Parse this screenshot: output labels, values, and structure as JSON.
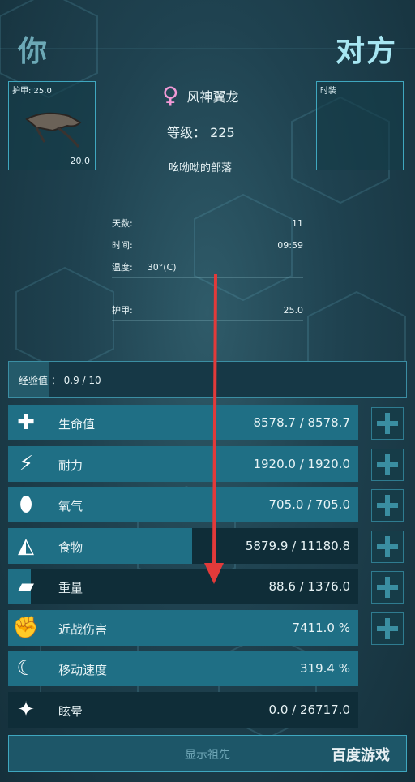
{
  "header": {
    "you": "你",
    "them": "对方"
  },
  "armor_slot": {
    "label": "护甲: 25.0",
    "value": "20.0"
  },
  "costume_slot": {
    "label": "时装"
  },
  "creature": {
    "name": "风神翼龙",
    "level_label": "等级：",
    "level_value": "225",
    "tribe": "吆呦呦的部落"
  },
  "info": [
    {
      "label": "天数:",
      "value": "11"
    },
    {
      "label": "时间:",
      "value": "09:59"
    },
    {
      "label": "温度:",
      "value": "30°(C)"
    },
    {
      "label": "",
      "value": ""
    },
    {
      "label": "护甲:",
      "value": "25.0"
    }
  ],
  "xp": {
    "text": "经验值 ： 0.9 / 10",
    "fraction": 0.1
  },
  "stats": [
    {
      "name": "health",
      "icon": "plus-cross-icon",
      "label": "生命值",
      "value": "8578.7 / 8578.7",
      "fraction": 1.0,
      "upgradable": true
    },
    {
      "name": "stamina",
      "icon": "lightning-icon",
      "label": "耐力",
      "value": "1920.0 / 1920.0",
      "fraction": 1.0,
      "upgradable": true
    },
    {
      "name": "oxygen",
      "icon": "oxygen-tank-icon",
      "label": "氧气",
      "value": "705.0 / 705.0",
      "fraction": 1.0,
      "upgradable": true
    },
    {
      "name": "food",
      "icon": "food-bag-icon",
      "label": "食物",
      "value": "5879.9 / 11180.8",
      "fraction": 0.526,
      "upgradable": true
    },
    {
      "name": "weight",
      "icon": "weight-icon",
      "label": "重量",
      "value": "88.6 / 1376.0",
      "fraction": 0.064,
      "upgradable": true
    },
    {
      "name": "melee",
      "icon": "fist-icon",
      "label": "近战伤害",
      "value": "7411.0 %",
      "fraction": 1.0,
      "upgradable": true
    },
    {
      "name": "speed",
      "icon": "foot-icon",
      "label": "移动速度",
      "value": "319.4 %",
      "fraction": 1.0,
      "upgradable": false
    },
    {
      "name": "torpor",
      "icon": "stars-icon",
      "label": "眩晕",
      "value": "0.0 / 26717.0",
      "fraction": 0.0,
      "upgradable": false
    }
  ],
  "ancestor_button": "显示祖先",
  "watermark": "百度游戏",
  "colors": {
    "accent": "#3fa7bf",
    "female": "#f39ad7",
    "arrow": "#e23a3a"
  }
}
